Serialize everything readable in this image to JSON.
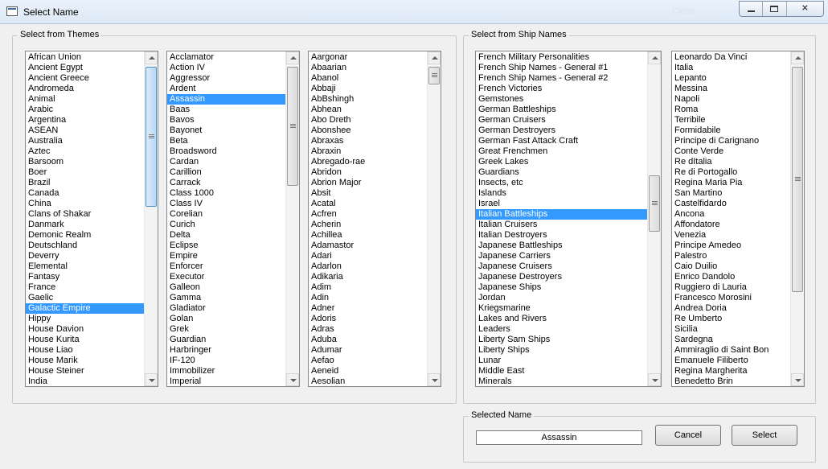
{
  "window": {
    "title": "Select Name",
    "ghost_text": "Close"
  },
  "themes": {
    "group_label": "Select from Themes",
    "list1": [
      "African Union",
      "Ancient Egypt",
      "Ancient Greece",
      "Andromeda",
      "Animal",
      "Arabic",
      "Argentina",
      "ASEAN",
      "Australia",
      "Aztec",
      "Barsoom",
      "Boer",
      "Brazil",
      "Canada",
      "China",
      "Clans of Shakar",
      "Danmark",
      "Demonic Realm",
      "Deutschland",
      "Deverry",
      "Elemental",
      "Fantasy",
      "France",
      "Gaelic",
      "Galactic Empire",
      "Hippy",
      "House Davion",
      "House Kurita",
      "House Liao",
      "House Marik",
      "House Steiner",
      "India"
    ],
    "list1_selected": "Galactic Empire",
    "list2": [
      "Acclamator",
      "Action IV",
      "Aggressor",
      "Ardent",
      "Assassin",
      "Baas",
      "Bavos",
      "Bayonet",
      "Beta",
      "Broadsword",
      "Cardan",
      "Carillion",
      "Carrack",
      "Class 1000",
      "Class IV",
      "Corelian",
      "Curich",
      "Delta",
      "Eclipse",
      "Empire",
      "Enforcer",
      "Executor",
      "Galleon",
      "Gamma",
      "Gladiator",
      "Golan",
      "Grek",
      "Guardian",
      "Harbringer",
      "IF-120",
      "Immobilizer",
      "Imperial"
    ],
    "list2_selected": "Assassin",
    "list3": [
      "Aargonar",
      "Abaarian",
      "Abanol",
      "Abbaji",
      "AbBshingh",
      "Abhean",
      "Abo Dreth",
      "Abonshee",
      "Abraxas",
      "Abraxin",
      "Abregado-rae",
      "Abridon",
      "Abrion Major",
      "Absit",
      "Acatal",
      "Acfren",
      "Acherin",
      "Achillea",
      "Adamastor",
      "Adari",
      "Adarlon",
      "Adikaria",
      "Adim",
      "Adin",
      "Adner",
      "Adoris",
      "Adras",
      "Aduba",
      "Adumar",
      "Aefao",
      "Aeneid",
      "Aesolian"
    ]
  },
  "ships": {
    "group_label": "Select from Ship Names",
    "list1": [
      "French Military Personalities",
      "French Ship Names - General #1",
      "French Ship Names - General #2",
      "French Victories",
      "Gemstones",
      "German Battleships",
      "German Cruisers",
      "German Destroyers",
      "German Fast Attack Craft",
      "Great Frenchmen",
      "Greek Lakes",
      "Guardians",
      "Insects, etc",
      "Islands",
      "Israel",
      "Italian Battleships",
      "Italian Cruisers",
      "Italian Destroyers",
      "Japanese Battleships",
      "Japanese Carriers",
      "Japanese Cruisers",
      "Japanese Destroyers",
      "Japanese Ships",
      "Jordan",
      "Kriegsmarine",
      "Lakes and Rivers",
      "Leaders",
      "Liberty Sam Ships",
      "Liberty Ships",
      "Lunar",
      "Middle East",
      "Minerals"
    ],
    "list1_selected": "Italian Battleships",
    "list2": [
      "Leonardo Da Vinci",
      "Italia",
      "Lepanto",
      "Messina",
      "Napoli",
      "Roma",
      "Terribile",
      "Formidabile",
      "Principe di Carignano",
      "Conte Verde",
      "Re dItalia",
      "Re di Portogallo",
      "Regina Maria Pia",
      "San Martino",
      "Castelfidardo",
      "Ancona",
      "Affondatore",
      "Venezia",
      "Principe Amedeo",
      "Palestro",
      "Caio Duilio",
      "Enrico Dandolo",
      "Ruggiero di Lauria",
      "Francesco Morosini",
      "Andrea Doria",
      "Re Umberto",
      "Sicilia",
      "Sardegna",
      "Ammiraglio di Saint Bon",
      "Emanuele Filiberto",
      "Regina Margherita",
      "Benedetto Brin"
    ]
  },
  "selected_name": {
    "group_label": "Selected Name",
    "value": "Assassin"
  },
  "buttons": {
    "cancel": "Cancel",
    "select": "Select"
  },
  "colors": {
    "selection": "#3399ff",
    "window_bg": "#f0f0f0"
  }
}
